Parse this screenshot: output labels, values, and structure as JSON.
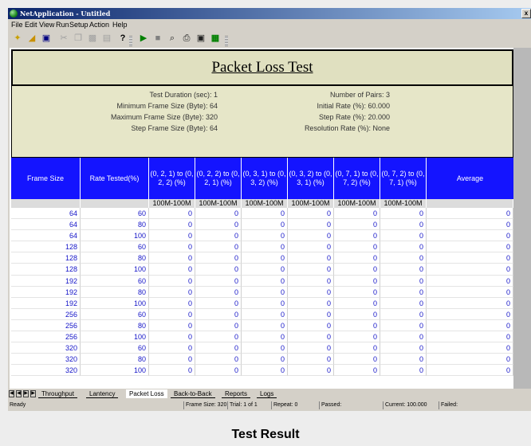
{
  "window": {
    "title": "NetApplication - Untitled",
    "close_glyph": "x"
  },
  "menu": [
    "File",
    "Edit",
    "View",
    "Run",
    "Setup",
    "Action",
    "Help"
  ],
  "toolbar_icons": [
    "new-wizard-icon",
    "open-folder-icon",
    "save-icon",
    "cut-icon",
    "copy-icon",
    "paste-icon",
    "properties-icon",
    "help-icon",
    "run-icon",
    "stop-icon",
    "zoom-icon",
    "print-icon",
    "print-preview-icon",
    "export-icon"
  ],
  "report": {
    "title": "Packet Loss Test",
    "params_left": [
      "Test Duration (sec): 1",
      "Minimum Frame Size (Byte): 64",
      "Maximum Frame Size (Byte): 320",
      "Step Frame Size (Byte): 64"
    ],
    "params_right": [
      "Number of Pairs: 3",
      "Initial Rate (%): 60.000",
      "Step Rate (%): 20.000",
      "Resolution Rate (%): None"
    ]
  },
  "table": {
    "headers": [
      "Frame Size",
      "Rate Tested(%)",
      "(0, 2, 1) to (0, 2, 2) (%)",
      "(0, 2, 2) to (0, 2, 1) (%)",
      "(0, 3, 1) to (0, 3, 2) (%)",
      "(0, 3, 2) to (0, 3, 1) (%)",
      "(0, 7, 1) to (0, 7, 2) (%)",
      "(0, 7, 2) to (0, 7, 1) (%)",
      "Average"
    ],
    "port_speeds": [
      "",
      "",
      "100M-100M",
      "100M-100M",
      "100M-100M",
      "100M-100M",
      "100M-100M",
      "100M-100M",
      ""
    ],
    "rows": [
      [
        "64",
        "60",
        "0",
        "0",
        "0",
        "0",
        "0",
        "0",
        "0"
      ],
      [
        "64",
        "80",
        "0",
        "0",
        "0",
        "0",
        "0",
        "0",
        "0"
      ],
      [
        "64",
        "100",
        "0",
        "0",
        "0",
        "0",
        "0",
        "0",
        "0"
      ],
      [
        "128",
        "60",
        "0",
        "0",
        "0",
        "0",
        "0",
        "0",
        "0"
      ],
      [
        "128",
        "80",
        "0",
        "0",
        "0",
        "0",
        "0",
        "0",
        "0"
      ],
      [
        "128",
        "100",
        "0",
        "0",
        "0",
        "0",
        "0",
        "0",
        "0"
      ],
      [
        "192",
        "60",
        "0",
        "0",
        "0",
        "0",
        "0",
        "0",
        "0"
      ],
      [
        "192",
        "80",
        "0",
        "0",
        "0",
        "0",
        "0",
        "0",
        "0"
      ],
      [
        "192",
        "100",
        "0",
        "0",
        "0",
        "0",
        "0",
        "0",
        "0"
      ],
      [
        "256",
        "60",
        "0",
        "0",
        "0",
        "0",
        "0",
        "0",
        "0"
      ],
      [
        "256",
        "80",
        "0",
        "0",
        "0",
        "0",
        "0",
        "0",
        "0"
      ],
      [
        "256",
        "100",
        "0",
        "0",
        "0",
        "0",
        "0",
        "0",
        "0"
      ],
      [
        "320",
        "60",
        "0",
        "0",
        "0",
        "0",
        "0",
        "0",
        "0"
      ],
      [
        "320",
        "80",
        "0",
        "0",
        "0",
        "0",
        "0",
        "0",
        "0"
      ],
      [
        "320",
        "100",
        "0",
        "0",
        "0",
        "0",
        "0",
        "0",
        "0"
      ]
    ]
  },
  "tabs": [
    "Throughput",
    "Lantency",
    "Packet Loss",
    "Back-to-Back",
    "Reports",
    "Logs"
  ],
  "active_tab": "Packet Loss",
  "status": {
    "ready": "Ready",
    "frame_size": "Frame Size: 320",
    "trial": "Trial: 1 of 1",
    "repeat": "Repeat: 0",
    "passed": "Passed:",
    "current": "Current: 100.000",
    "failed": "Failed:"
  },
  "caption": "Test Result",
  "colors": {
    "header_blue": "#1414ff",
    "title_band": "#e0e0c0",
    "value_text": "#1414c8"
  }
}
